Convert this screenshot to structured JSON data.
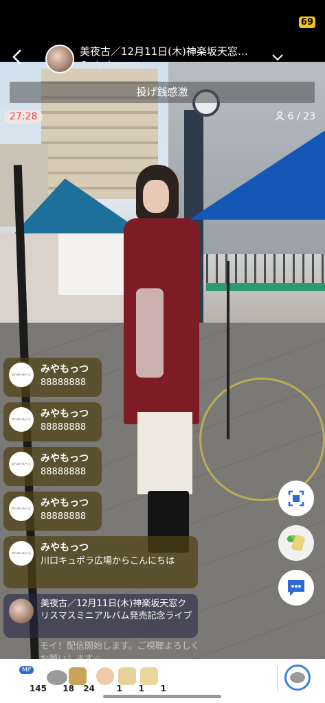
{
  "status": {
    "battery": "69"
  },
  "header": {
    "title": "美夜古／12月11日(木)神楽坂天窓…",
    "handle": "@miyakonosco"
  },
  "gift_bar": {
    "label": "投げ銭感激"
  },
  "stream": {
    "elapsed": "27:28",
    "viewers": "6 / 23"
  },
  "comments": [
    {
      "name": "みやもっつ",
      "text": "88888888",
      "avatar": "のへのへもへじ"
    },
    {
      "name": "みやもっつ",
      "text": "88888888",
      "avatar": "のへのへもへじ"
    },
    {
      "name": "みやもっつ",
      "text": "88888888",
      "avatar": "のへのへもへじ"
    },
    {
      "name": "みやもっつ",
      "text": "88888888",
      "avatar": "のへのへもへじ"
    },
    {
      "name": "みやもっつ",
      "text": "川口キュポラ広場からこんにちは",
      "avatar": "のへのへもへじ"
    },
    {
      "name": "",
      "text": "美夜古／12月11日(木)神楽坂天窓クリスマスミニアルバム発売記念ライブ",
      "avatar": ""
    }
  ],
  "faded_message": "モイ！配信開始します。ご視聴よろしくお願いします☆",
  "toolbar": {
    "items": [
      {
        "icon": "mp-icon",
        "badge": "MP",
        "count": "145"
      },
      {
        "icon": "coin-icon",
        "count": "18"
      },
      {
        "icon": "present-icon",
        "count": "24"
      },
      {
        "icon": "clap-icon",
        "count": "1"
      },
      {
        "icon": "heart-item-icon",
        "count": "1"
      },
      {
        "icon": "gift-item-icon",
        "count": "1"
      }
    ]
  },
  "colors": {
    "accent": "#2d6ad6",
    "timer": "#e04a4a",
    "comment_bg": "#504114"
  }
}
